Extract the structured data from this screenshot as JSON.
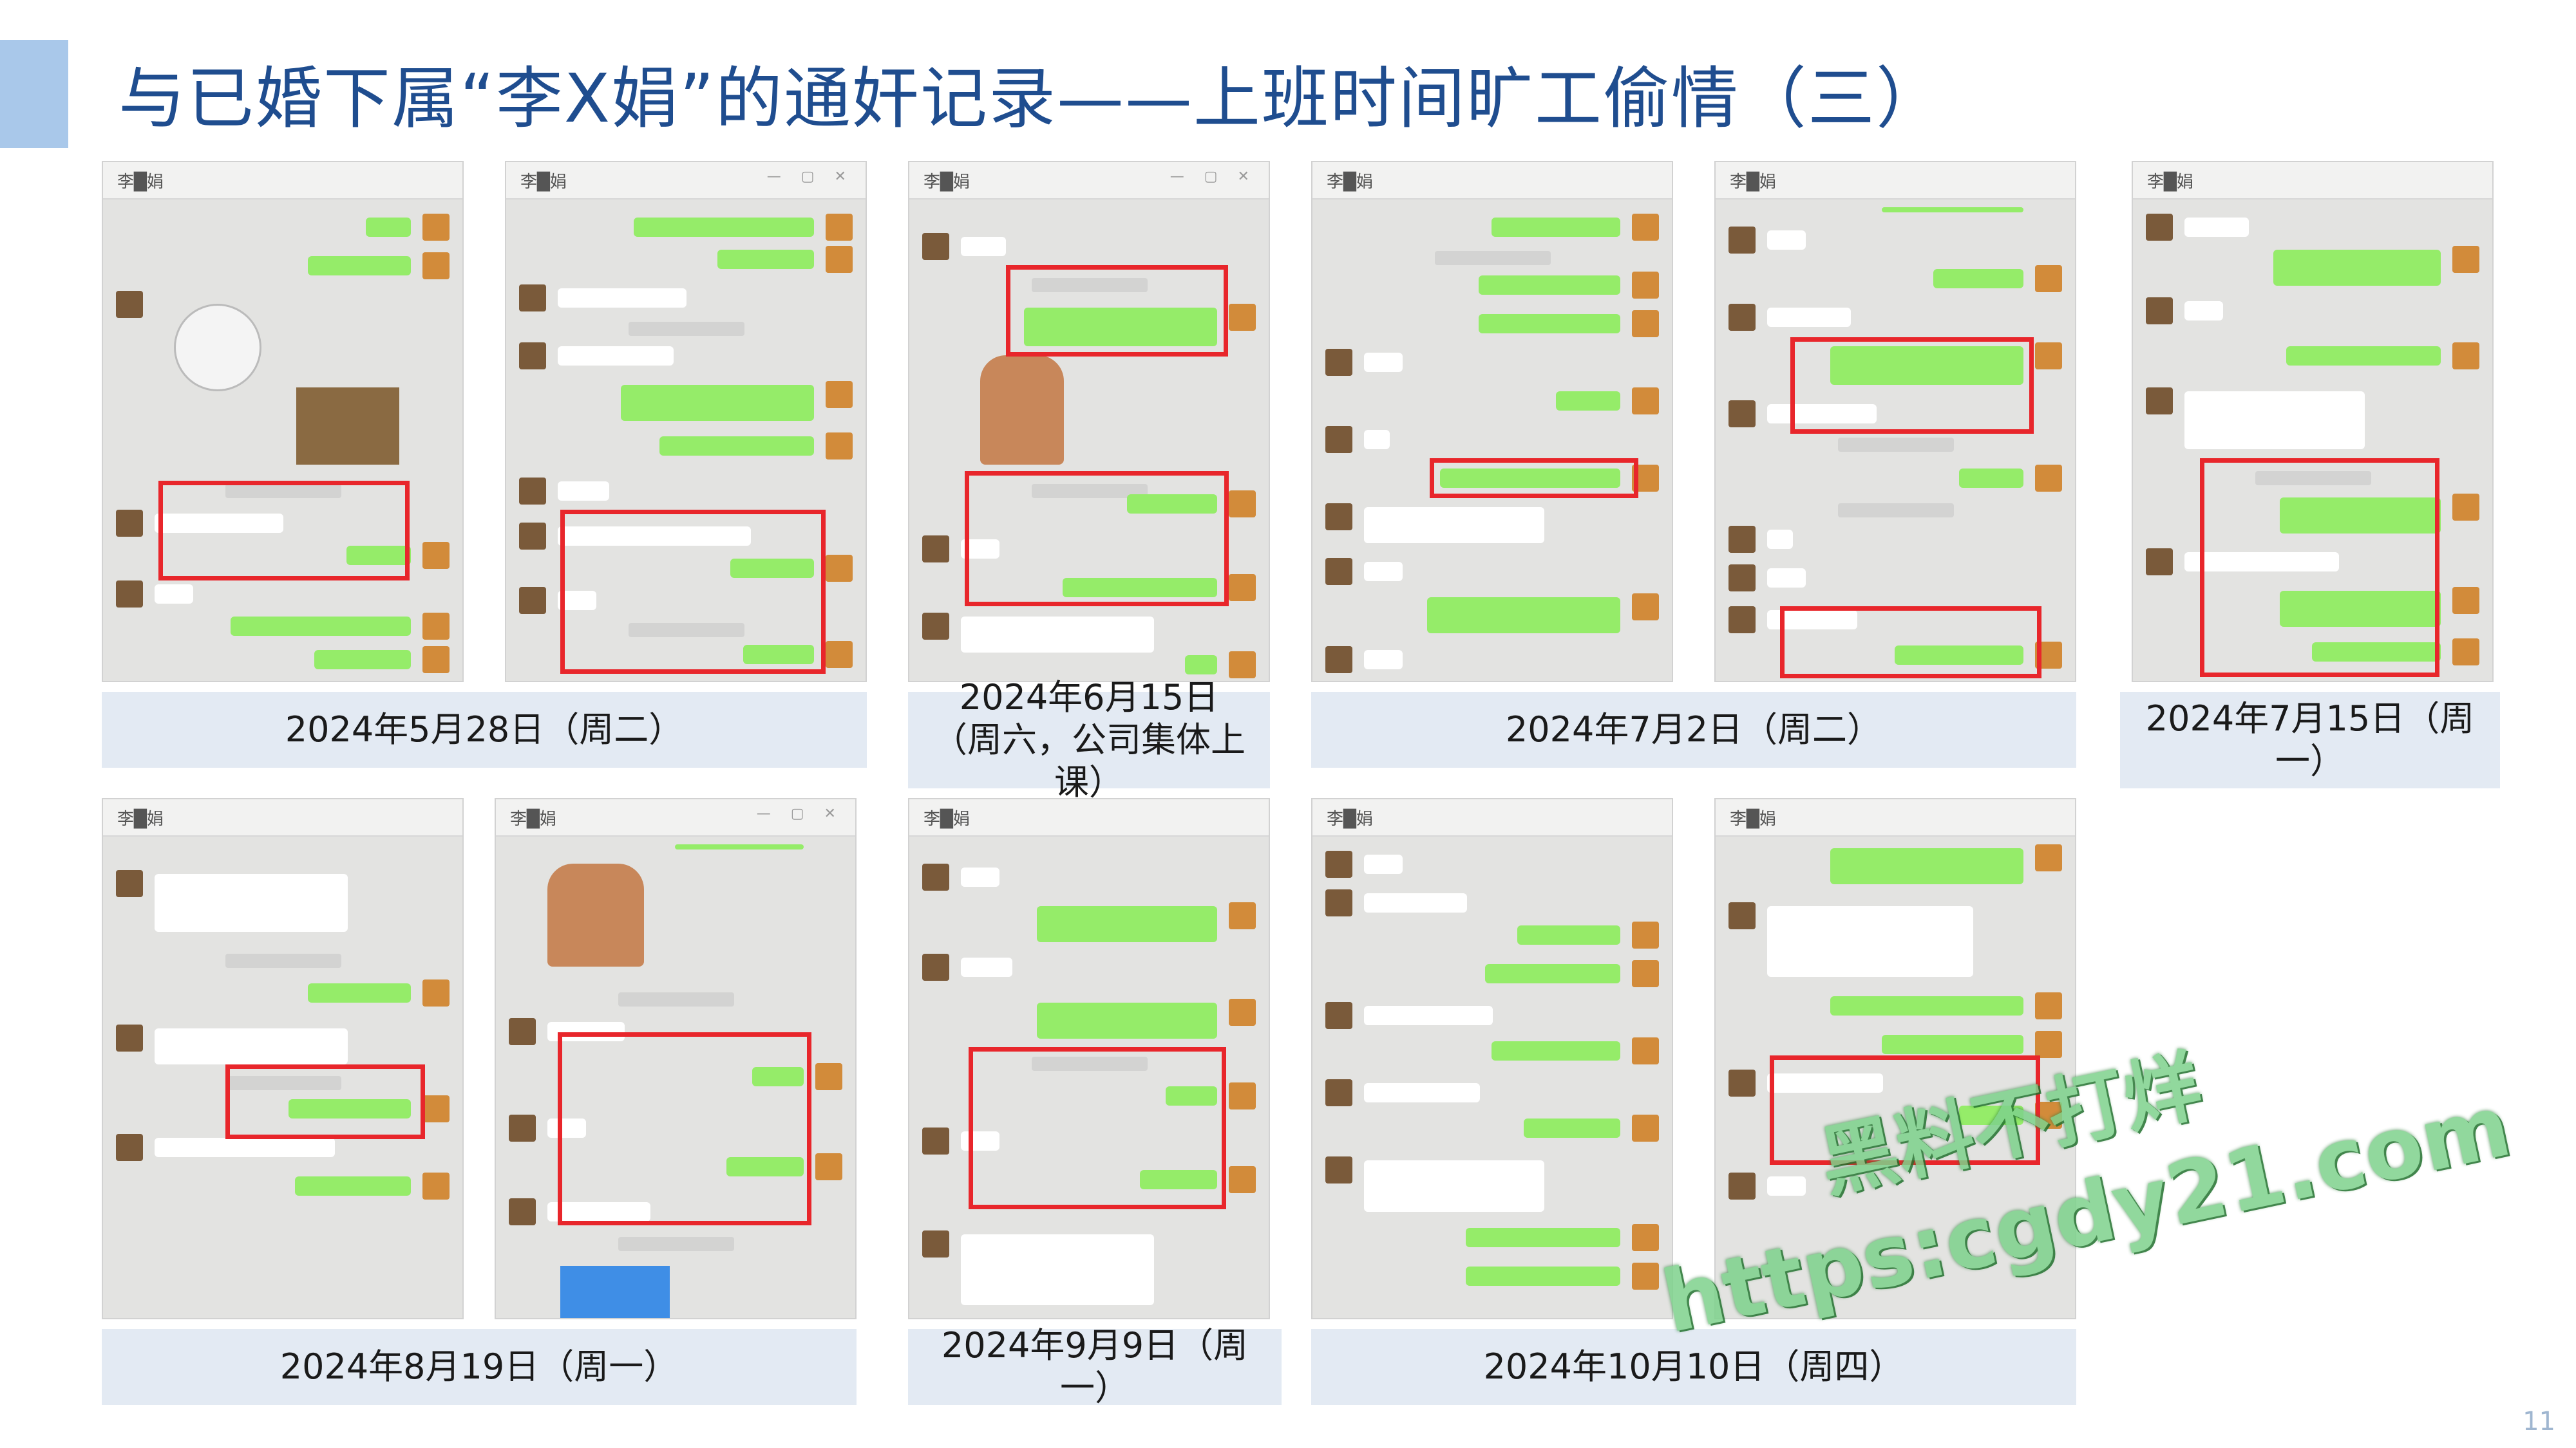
{
  "header": {
    "title": "与已婚下属“李X娟”的通奸记录——上班时间旷工偷情（三）"
  },
  "screenshots": {
    "contact_name": "李",
    "contact_suffix": "娟",
    "window_controls": "— ▢ ✕"
  },
  "captions": [
    {
      "id": "may28",
      "text": "2024年5月28日（周二）"
    },
    {
      "id": "jun15",
      "text": "2024年6月15日（周六，公司集体上课）"
    },
    {
      "id": "jul2",
      "text": "2024年7月2日（周二）"
    },
    {
      "id": "jul15",
      "text": "2024年7月15日（周一）"
    },
    {
      "id": "aug19",
      "text": "2024年8月19日（周一）"
    },
    {
      "id": "sep9",
      "text": "2024年9月9日（周一）"
    },
    {
      "id": "oct10",
      "text": "2024年10月10日（周四）"
    }
  ],
  "watermark": {
    "line1": "黑料不打烊",
    "line2": "https:cgdy21.com"
  },
  "page_number": "11",
  "colors": {
    "title": "#1f4d8f",
    "accent_bar": "#a9c8ea",
    "caption_bg": "#e3eaf3",
    "highlight": "#e8262b",
    "chat_green": "#95ec69",
    "watermark": "#7ed28c"
  }
}
